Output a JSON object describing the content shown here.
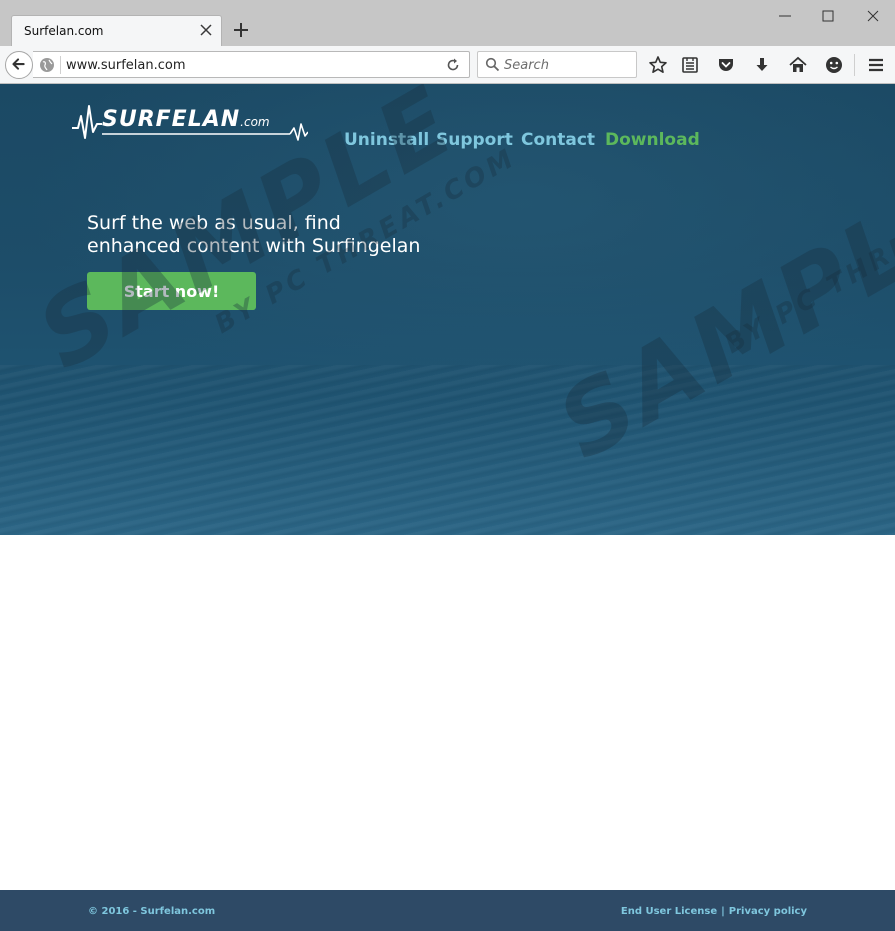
{
  "browser": {
    "tab_title": "Surfelan.com",
    "url": "www.surfelan.com",
    "search_placeholder": "Search"
  },
  "page": {
    "logo": {
      "text": "SURFELAN",
      "suffix": ".com"
    },
    "nav": [
      "Uninstall",
      "Support",
      "Contact",
      "Download"
    ],
    "headline_line1": "Surf the web as usual, find",
    "headline_line2": "enhanced content with Surfingelan",
    "cta_label": "Start now!",
    "watermarks": {
      "main": "SAMPLE",
      "sub": "BY PC THREAT.COM"
    }
  },
  "footer": {
    "copyright": "© 2016 - Surfelan.com",
    "links": [
      "End User License",
      "Privacy policy"
    ],
    "separator": "|"
  },
  "colors": {
    "accent_green": "#5cb85c",
    "nav_blue": "#7fc7de",
    "hero_bg": "#1d4d69",
    "footer_bg": "#2e4a66"
  }
}
